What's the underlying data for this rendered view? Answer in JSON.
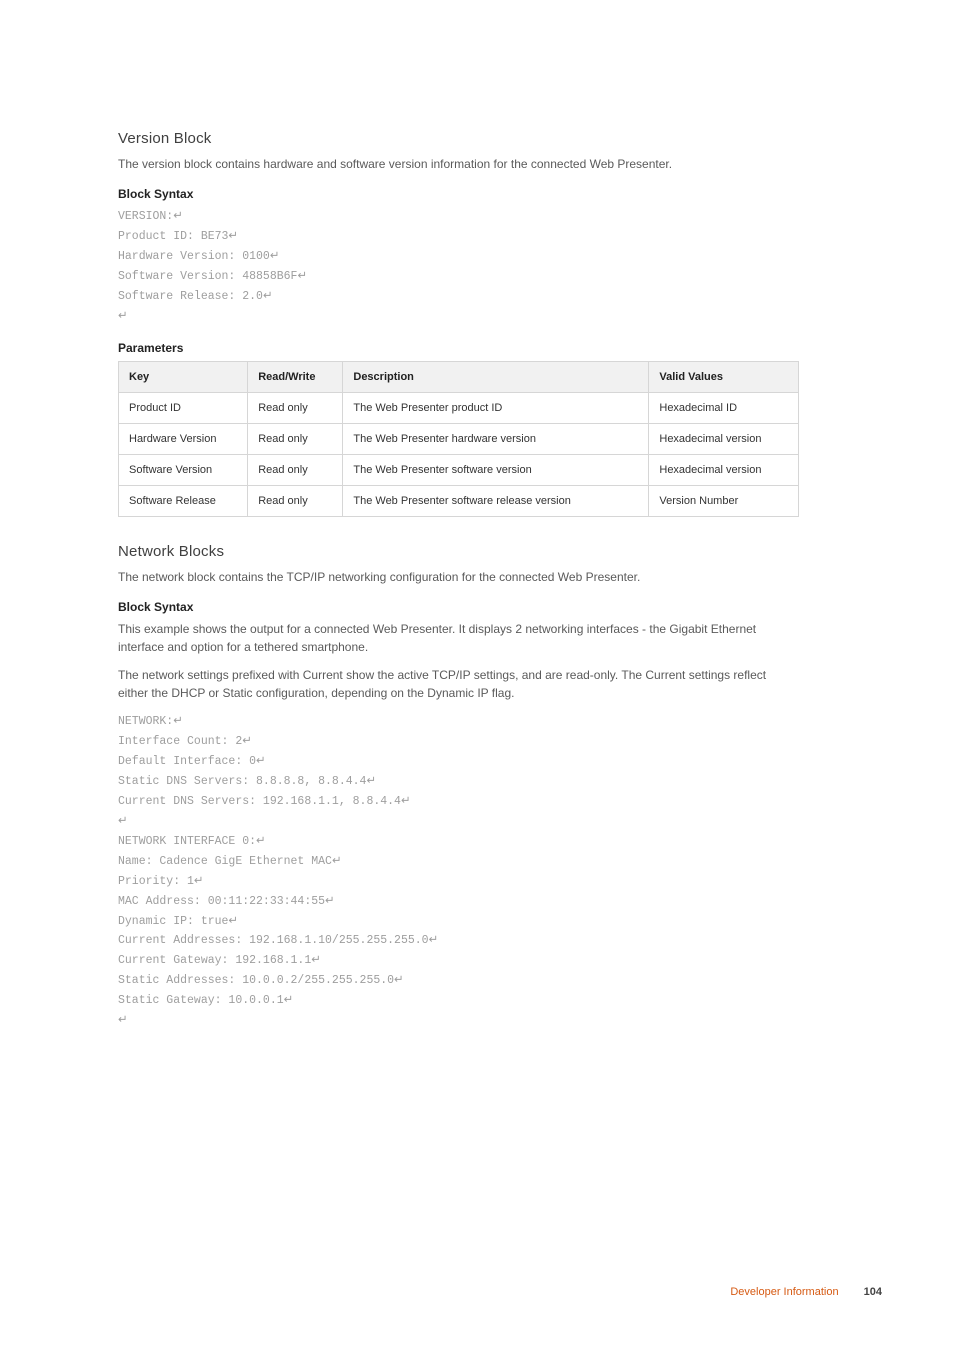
{
  "version_block": {
    "heading": "Version Block",
    "intro": "The version block contains hardware and software version information for the connected Web Presenter.",
    "syntax_heading": "Block Syntax",
    "code": {
      "l1": "VERSION:",
      "l2": "Product ID: BE73",
      "l3": "Hardware Version: 0100",
      "l4": "Software Version: 48858B6F",
      "l5": "Software Release: 2.0"
    },
    "params_heading": "Parameters",
    "table": {
      "headers": {
        "key": "Key",
        "rw": "Read/Write",
        "desc": "Description",
        "vv": "Valid Values"
      },
      "rows": [
        {
          "key": "Product ID",
          "rw": "Read only",
          "desc": "The Web Presenter product ID",
          "vv": "Hexadecimal ID"
        },
        {
          "key": "Hardware Version",
          "rw": "Read only",
          "desc": "The Web Presenter hardware version",
          "vv": "Hexadecimal version"
        },
        {
          "key": "Software Version",
          "rw": "Read only",
          "desc": "The Web Presenter software version",
          "vv": "Hexadecimal version"
        },
        {
          "key": "Software Release",
          "rw": "Read only",
          "desc": "The Web Presenter software release version",
          "vv": "Version Number"
        }
      ]
    }
  },
  "network_blocks": {
    "heading": "Network Blocks",
    "intro": "The network block contains the TCP/IP networking configuration for the connected Web Presenter.",
    "syntax_heading": "Block Syntax",
    "p1": "This example shows the output for a connected Web Presenter. It displays 2 networking interfaces - the Gigabit Ethernet interface and option for a tethered smartphone.",
    "p2": "The network settings prefixed with Current show the active TCP/IP settings, and are read-only. The Current settings reflect either the DHCP or Static configuration, depending on the Dynamic IP flag.",
    "code": {
      "l1": "NETWORK:",
      "l2": "Interface Count: 2",
      "l3": "Default Interface: 0",
      "l4": "Static DNS Servers: 8.8.8.8, 8.8.4.4",
      "l5": "Current DNS Servers: 192.168.1.1, 8.8.4.4",
      "l6": "",
      "l7": "NETWORK INTERFACE 0:",
      "l8": "Name: Cadence GigE Ethernet MAC",
      "l9": "Priority: 1",
      "l10": "MAC Address: 00:11:22:33:44:55",
      "l11": "Dynamic IP: true",
      "l12": "Current Addresses: 192.168.1.10/255.255.255.0",
      "l13": "Current Gateway: 192.168.1.1",
      "l14": "Static Addresses: 10.0.0.2/255.255.255.0",
      "l15": "Static Gateway: 10.0.0.1"
    }
  },
  "footer": {
    "label": "Developer Information",
    "page": "104"
  }
}
